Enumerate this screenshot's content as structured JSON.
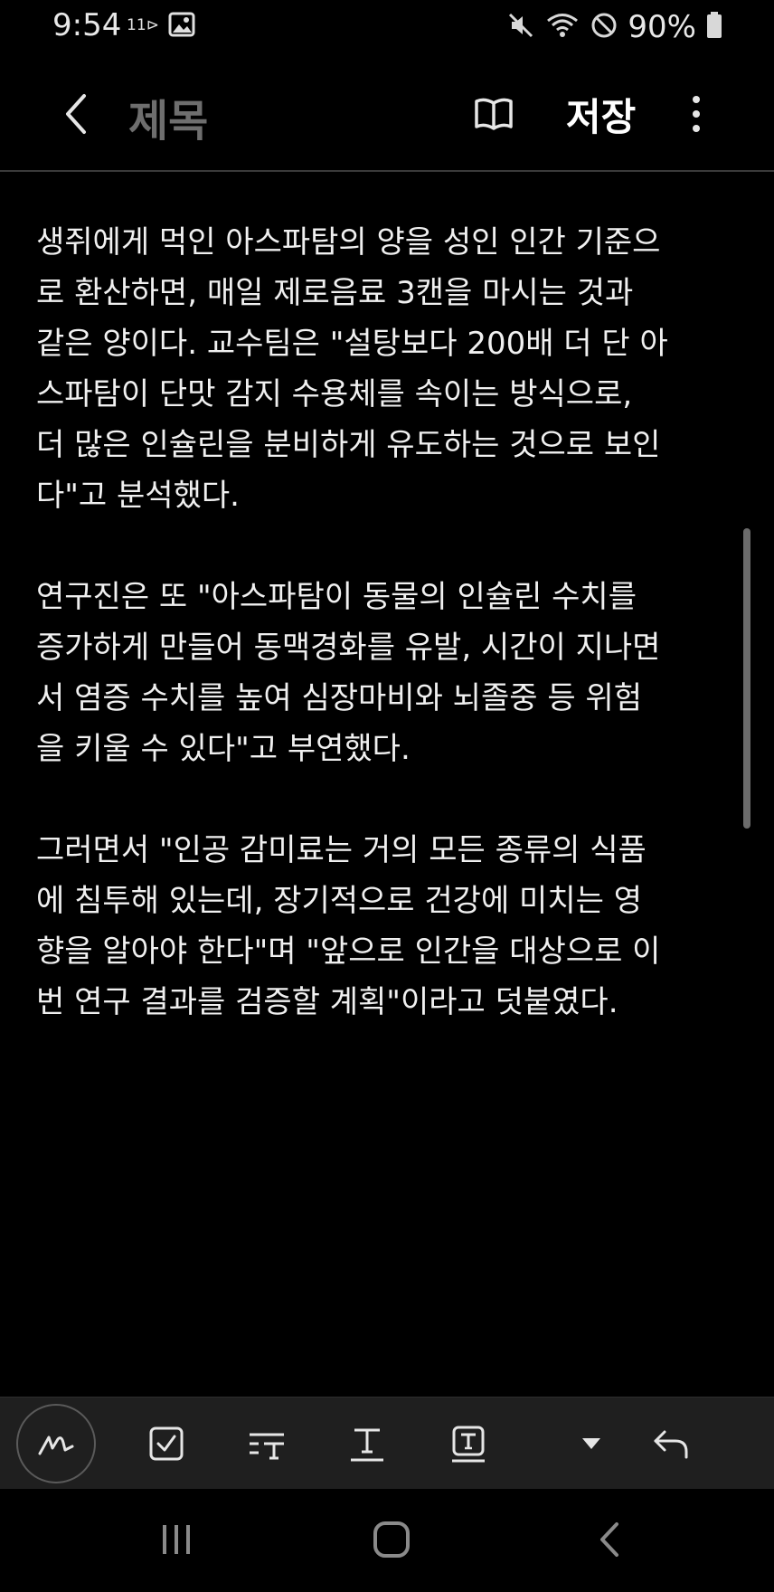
{
  "status_bar": {
    "time": "9:54",
    "carrier_badge": "11",
    "battery_percent": "90%"
  },
  "header": {
    "title_placeholder": "제목",
    "save_label": "저장"
  },
  "note": {
    "paragraphs": [
      "생쥐에게 먹인 아스파탐의 양을 성인 인간 기준으\n로 환산하면, 매일 제로음료 3캔을 마시는 것과\n같은 양이다. 교수팀은 \"설탕보다 200배 더 단 아\n스파탐이 단맛 감지 수용체를 속이는 방식으로,\n더 많은 인슐린을 분비하게 유도하는 것으로 보인\n다\"고 분석했다.",
      "연구진은 또 \"아스파탐이 동물의 인슐린 수치를\n증가하게 만들어 동맥경화를 유발, 시간이 지나면\n서 염증 수치를 높여 심장마비와 뇌졸중 등 위험\n을 키울 수 있다\"고 부연했다.",
      "그러면서 \"인공 감미료는 거의 모든 종류의 식품\n에 침투해 있는데, 장기적으로 건강에 미치는 영\n향을 알아야 한다\"며 \"앞으로 인간을 대상으로 이\n번 연구 결과를 검증할 계획\"이라고 덧붙였다."
    ]
  },
  "toolbar": {
    "tools": [
      "pen-tool",
      "checkbox-tool",
      "text-style-tool",
      "text-format-tool",
      "text-box-tool",
      "expand-tool",
      "undo-tool"
    ]
  },
  "icons": {
    "back": "back-arrow-icon",
    "reader": "reader-mode-icon",
    "more": "more-options-icon"
  },
  "colors": {
    "background": "#000000",
    "toolbar_bg": "#1f1f1f",
    "text": "#f0f0f0",
    "title_placeholder": "#6e6e6e"
  }
}
